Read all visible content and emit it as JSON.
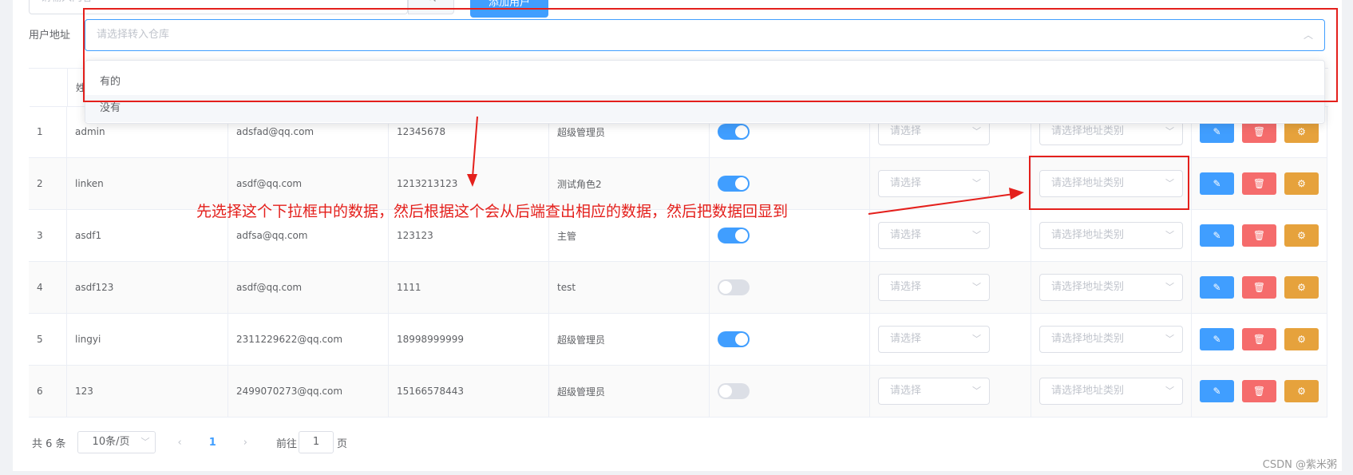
{
  "search": {
    "placeholder": "请输入内容"
  },
  "toolbar": {
    "add_label": "添加用户"
  },
  "address": {
    "label": "用户地址",
    "placeholder": "请选择转入仓库"
  },
  "dropdown_options": [
    "有的",
    "没有"
  ],
  "header_visible": "姓",
  "rows": [
    {
      "index": "1",
      "name": "admin",
      "email": "adsfad@qq.com",
      "phone": "12345678",
      "role": "超级管理员",
      "state": "on",
      "select_placeholder": "请选择",
      "addr_type_placeholder": "请选择地址类别"
    },
    {
      "index": "2",
      "name": "linken",
      "email": "asdf@qq.com",
      "phone": "1213213123",
      "role": "测试角色2",
      "state": "on",
      "select_placeholder": "请选择",
      "addr_type_placeholder": "请选择地址类别"
    },
    {
      "index": "3",
      "name": "asdf1",
      "email": "adfsa@qq.com",
      "phone": "123123",
      "role": "主管",
      "state": "on",
      "select_placeholder": "请选择",
      "addr_type_placeholder": "请选择地址类别"
    },
    {
      "index": "4",
      "name": "asdf123",
      "email": "asdf@qq.com",
      "phone": "1111",
      "role": "test",
      "state": "off",
      "select_placeholder": "请选择",
      "addr_type_placeholder": "请选择地址类别"
    },
    {
      "index": "5",
      "name": "lingyi",
      "email": "2311229622@qq.com",
      "phone": "18998999999",
      "role": "超级管理员",
      "state": "on",
      "select_placeholder": "请选择",
      "addr_type_placeholder": "请选择地址类别"
    },
    {
      "index": "6",
      "name": "123",
      "email": "2499070273@qq.com",
      "phone": "15166578443",
      "role": "超级管理员",
      "state": "off",
      "select_placeholder": "请选择",
      "addr_type_placeholder": "请选择地址类别"
    }
  ],
  "annotation": "先选择这个下拉框中的数据，然后根据这个会从后端查出相应的数据，然后把数据回显到",
  "pagination": {
    "total": "共 6 条",
    "page_size": "10条/页",
    "current": "1",
    "goto_label": "前往",
    "goto_value": "1",
    "page_suffix": "页"
  },
  "watermark": "CSDN @紫米粥",
  "colors": {
    "primary": "#409eff",
    "danger": "#f56c6c",
    "warning": "#e6a23c",
    "annotation": "#e4201c"
  },
  "icons": {
    "search": "search-icon",
    "edit": "edit-icon",
    "delete": "delete-icon",
    "settings": "settings-icon"
  }
}
